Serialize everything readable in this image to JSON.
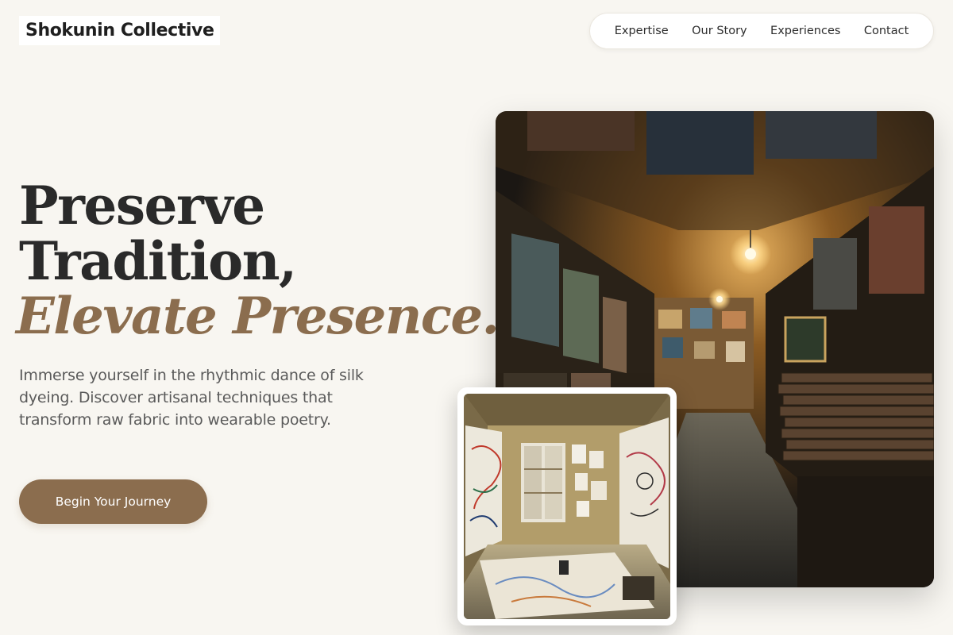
{
  "header": {
    "logo": "Shokunin Collective",
    "nav": [
      "Expertise",
      "Our Story",
      "Experiences",
      "Contact"
    ]
  },
  "hero": {
    "headline_line1": "Preserve",
    "headline_line2": "Tradition,",
    "headline_accent": "Elevate Presence.",
    "lead": "Immerse yourself in the rhythmic dance of silk dyeing. Discover artisanal techniques that transform raw fabric into wearable poetry.",
    "cta_label": "Begin Your Journey"
  },
  "colors": {
    "background": "#f8f6f1",
    "accent": "#8b6d4e",
    "text": "#2a2a2a",
    "muted_text": "#5a5a5a"
  }
}
